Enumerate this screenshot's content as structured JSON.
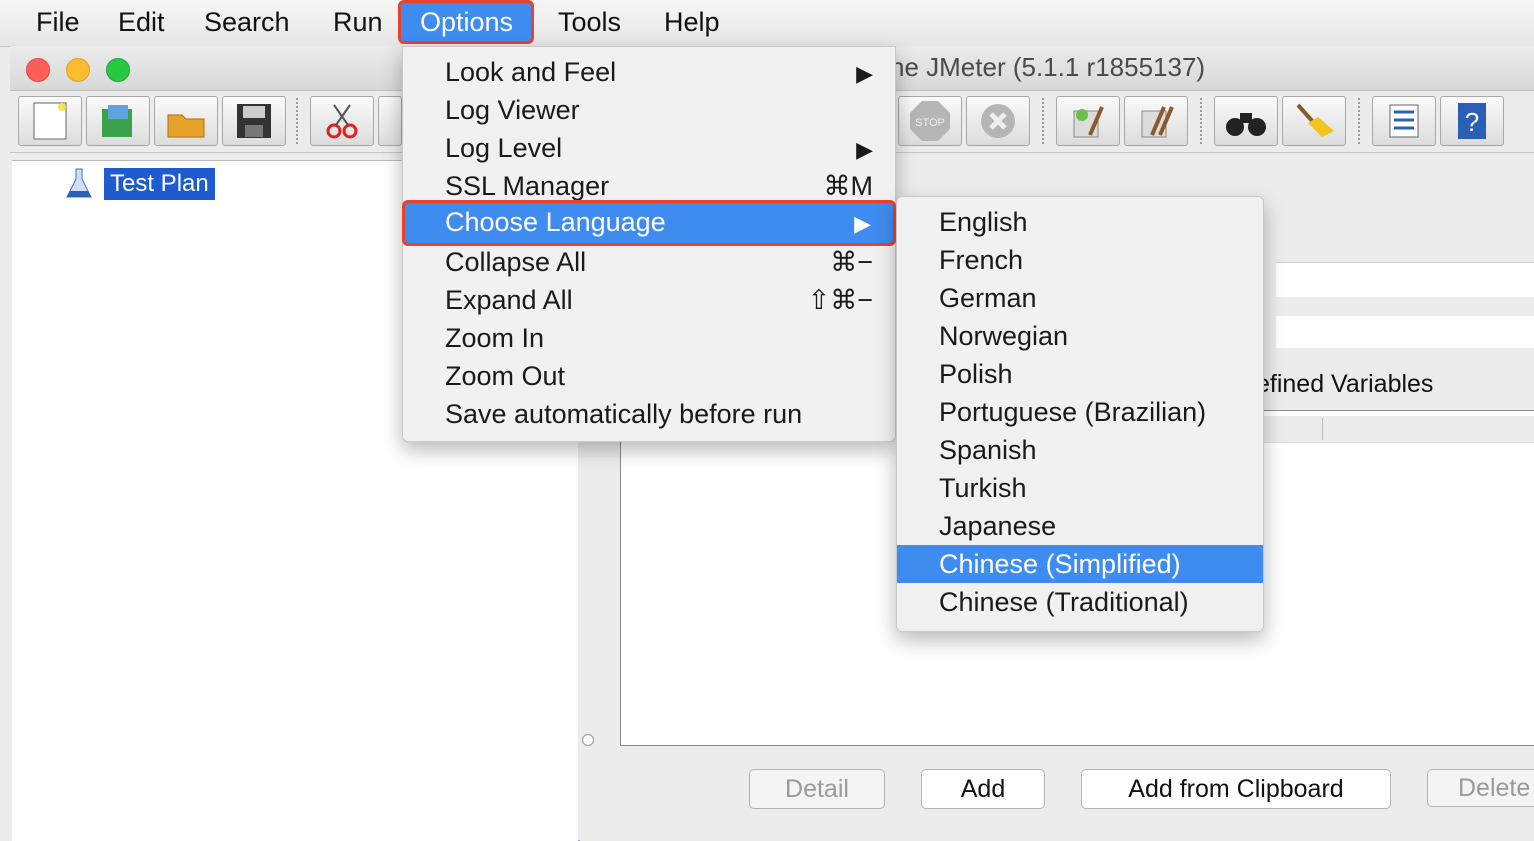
{
  "menubar": {
    "items": [
      "File",
      "Edit",
      "Search",
      "Run",
      "Options",
      "Tools",
      "Help"
    ],
    "active": "Options"
  },
  "window": {
    "title": "he JMeter (5.1.1 r1855137)"
  },
  "tree": {
    "root_label": "Test Plan"
  },
  "options_menu": {
    "items": [
      {
        "label": "Look and Feel",
        "shortcut": "",
        "submenu": true
      },
      {
        "label": "Log Viewer",
        "shortcut": "",
        "submenu": false
      },
      {
        "label": "Log Level",
        "shortcut": "",
        "submenu": true
      },
      {
        "label": "SSL Manager",
        "shortcut": "⌘M",
        "submenu": false
      },
      {
        "label": "Choose Language",
        "shortcut": "",
        "submenu": true
      },
      {
        "label": "Collapse All",
        "shortcut": "⌘−",
        "submenu": false
      },
      {
        "label": "Expand All",
        "shortcut": "⇧⌘−",
        "submenu": false
      },
      {
        "label": "Zoom In",
        "shortcut": "",
        "submenu": false
      },
      {
        "label": "Zoom Out",
        "shortcut": "",
        "submenu": false
      },
      {
        "label": "Save automatically before run",
        "shortcut": "",
        "submenu": false
      }
    ],
    "highlighted": "Choose Language"
  },
  "language_submenu": {
    "items": [
      "English",
      "French",
      "German",
      "Norwegian",
      "Polish",
      "Portuguese (Brazilian)",
      "Spanish",
      "Turkish",
      "Japanese",
      "Chinese (Simplified)",
      "Chinese (Traditional)"
    ],
    "highlighted": "Chinese (Simplified)"
  },
  "main": {
    "udv_label": "efined Variables",
    "buttons": {
      "detail": "Detail",
      "add": "Add",
      "add_from_clipboard": "Add from Clipboard",
      "delete": "Delete"
    }
  },
  "arrow_glyph": "▶",
  "colors": {
    "highlight": "#3f8cf0",
    "callout": "#e8432a",
    "tree_selection": "#1f5bd0"
  }
}
